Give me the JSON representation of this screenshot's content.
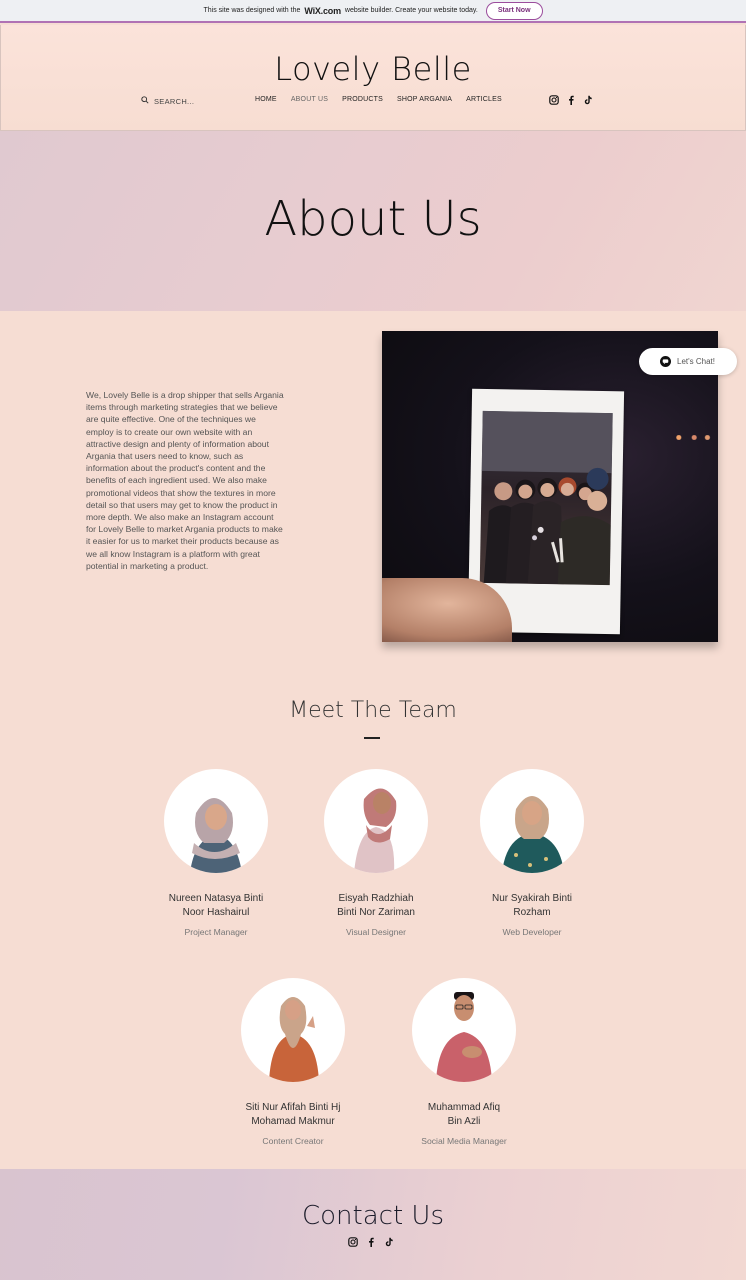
{
  "wix_banner": {
    "text_before": "This site was designed with the",
    "logo": "WiX.com",
    "text_after": "website builder. Create your website today.",
    "button_label": "Start Now"
  },
  "header": {
    "site_title": "Lovely Belle",
    "search_placeholder": "SEARCH...",
    "nav": [
      "HOME",
      "ABOUT US",
      "PRODUCTS",
      "SHOP ARGANIA",
      "ARTICLES"
    ],
    "active_nav": "ABOUT US",
    "socials": [
      "instagram-icon",
      "facebook-icon",
      "tiktok-icon"
    ]
  },
  "hero": {
    "title": "About Us"
  },
  "about": {
    "paragraph": "We, Lovely Belle is a drop shipper that sells Argania items through marketing strategies that we believe are quite effective. One of the techniques we employ is to create our own website with an attractive design and plenty of information about Argania that users need to know, such as information about the product's content and the benefits of each ingredient used. We also make promotional videos that show the textures in more detail so that users may get to know the product in more depth. We also make an Instagram account for Lovely Belle to market Argania products to make it easier for us to market their products because as we all know Instagram is a platform with great potential in marketing a product."
  },
  "chat": {
    "label": "Let's Chat!"
  },
  "team": {
    "title": "Meet The Team",
    "members": [
      {
        "name_line1": "Nureen Natasya Binti",
        "name_line2": "Noor Hashairul",
        "role": "Project Manager"
      },
      {
        "name_line1": "Eisyah Radzhiah",
        "name_line2": "Binti Nor Zariman",
        "role": "Visual Designer"
      },
      {
        "name_line1": "Nur Syakirah Binti",
        "name_line2": "Rozham",
        "role": "Web Developer"
      },
      {
        "name_line1": "Siti Nur Afifah Binti Hj",
        "name_line2": "Mohamad Makmur",
        "role": "Content Creator"
      },
      {
        "name_line1": "Muhammad Afiq",
        "name_line2": "Bin Azli",
        "role": "Social Media Manager"
      }
    ]
  },
  "contact": {
    "title": "Contact Us"
  },
  "colors": {
    "page_bg": "#f6ddd3",
    "wix_accent": "#9b4d9d",
    "text": "#333333"
  }
}
